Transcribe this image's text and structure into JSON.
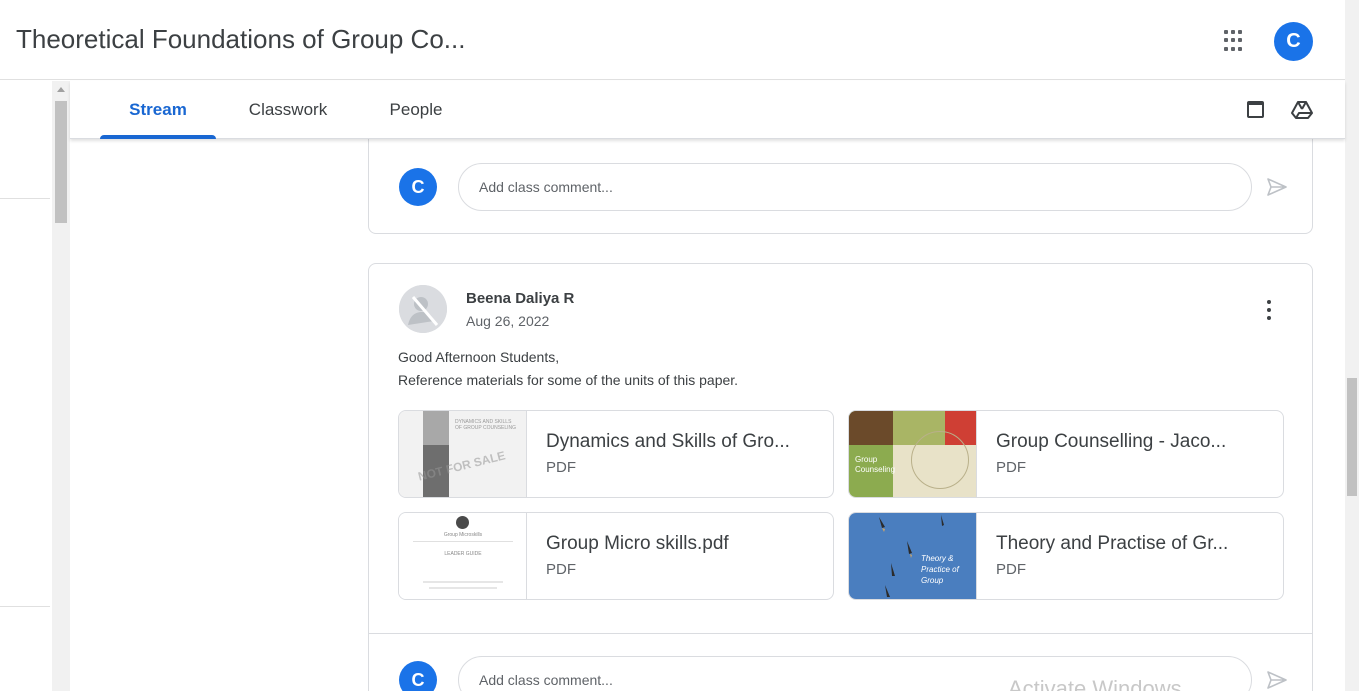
{
  "header": {
    "class_title": "Theoretical Foundations of Group Co...",
    "account_initial": "C"
  },
  "tabs": [
    {
      "label": "Stream",
      "active": true
    },
    {
      "label": "Classwork",
      "active": false
    },
    {
      "label": "People",
      "active": false
    }
  ],
  "top_comment": {
    "avatar_initial": "C",
    "placeholder": "Add class comment..."
  },
  "post": {
    "author": "Beena Daliya R",
    "date": "Aug 26, 2022",
    "body_line1": "Good Afternoon Students,",
    "body_line2": "Reference materials for some of the units of this paper.",
    "attachments": [
      {
        "title": "Dynamics and Skills of Gro...",
        "type": "PDF"
      },
      {
        "title": "Group Counselling - Jaco...",
        "type": "PDF"
      },
      {
        "title": "Group Micro skills.pdf",
        "type": "PDF"
      },
      {
        "title": "Theory and Practise of Gr...",
        "type": "PDF"
      }
    ],
    "thumb_text": {
      "dynamics": "DYNAMICS AND SKILLS OF GROUP COUNSELING",
      "dynamics_stamp": "NOT FOR SALE",
      "counselling": "Group Counseling",
      "micro_title": "Group Microskills",
      "micro_subtitle": "LEADER GUIDE",
      "theory": "Theory & Practice of Group"
    }
  },
  "bottom_comment": {
    "avatar_initial": "C",
    "placeholder": "Add class comment..."
  },
  "watermark": "Activate Windows",
  "colors": {
    "accent": "#1967d2",
    "avatar": "#1a73e8"
  }
}
